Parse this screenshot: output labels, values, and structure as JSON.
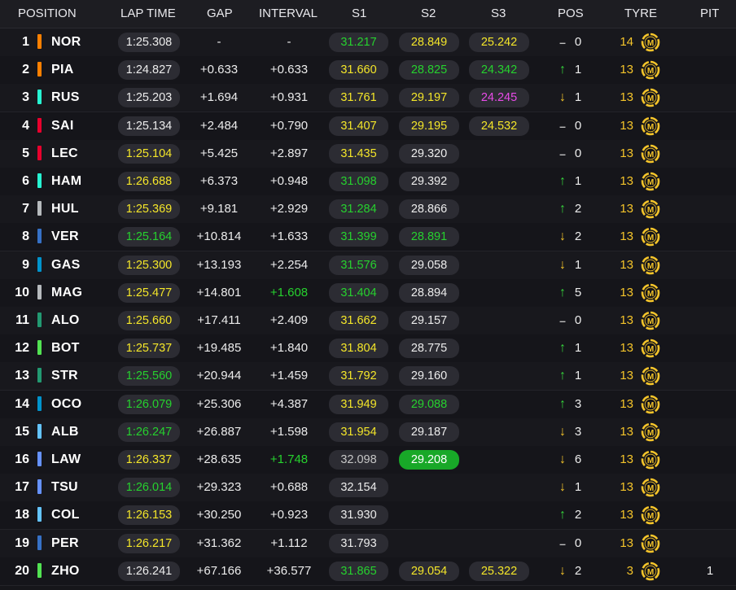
{
  "headers": {
    "position": "POSITION",
    "lap_time": "LAP TIME",
    "gap": "GAP",
    "interval": "INTERVAL",
    "s1": "S1",
    "s2": "S2",
    "s3": "S3",
    "pos": "POS",
    "tyre": "TYRE",
    "pit": "PIT"
  },
  "colors": {
    "green": "#26d12e",
    "yellow": "#f4e629",
    "purple": "#e84be8",
    "tyre_medium": "#f4c42a"
  },
  "rows": [
    {
      "pos": "1",
      "code": "NOR",
      "team_color": "#ff8000",
      "lap": "1:25.308",
      "lap_c": "white",
      "gap": "-",
      "interval": "-",
      "int_c": "white",
      "s1": "31.217",
      "s1_c": "green",
      "s2": "28.849",
      "s2_c": "yellow",
      "s3": "25.242",
      "s3_c": "yellow",
      "arrow": "same",
      "change": "0",
      "laps": "14",
      "tyre": "M",
      "pit": ""
    },
    {
      "pos": "2",
      "code": "PIA",
      "team_color": "#ff8000",
      "lap": "1:24.827",
      "lap_c": "white",
      "gap": "+0.633",
      "interval": "+0.633",
      "int_c": "white",
      "s1": "31.660",
      "s1_c": "yellow",
      "s2": "28.825",
      "s2_c": "green",
      "s3": "24.342",
      "s3_c": "green",
      "arrow": "up",
      "change": "1",
      "laps": "13",
      "tyre": "M",
      "pit": ""
    },
    {
      "pos": "3",
      "code": "RUS",
      "team_color": "#27f4d2",
      "lap": "1:25.203",
      "lap_c": "white",
      "gap": "+1.694",
      "interval": "+0.931",
      "int_c": "white",
      "s1": "31.761",
      "s1_c": "yellow",
      "s2": "29.197",
      "s2_c": "yellow",
      "s3": "24.245",
      "s3_c": "purple",
      "arrow": "down",
      "change": "1",
      "laps": "13",
      "tyre": "M",
      "pit": ""
    },
    {
      "pos": "4",
      "code": "SAI",
      "team_color": "#e8002d",
      "lap": "1:25.134",
      "lap_c": "white",
      "gap": "+2.484",
      "interval": "+0.790",
      "int_c": "white",
      "s1": "31.407",
      "s1_c": "yellow",
      "s2": "29.195",
      "s2_c": "yellow",
      "s3": "24.532",
      "s3_c": "yellow",
      "arrow": "same",
      "change": "0",
      "laps": "13",
      "tyre": "M",
      "pit": ""
    },
    {
      "pos": "5",
      "code": "LEC",
      "team_color": "#e8002d",
      "lap": "1:25.104",
      "lap_c": "yellow",
      "gap": "+5.425",
      "interval": "+2.897",
      "int_c": "white",
      "s1": "31.435",
      "s1_c": "yellow",
      "s2": "29.320",
      "s2_c": "white",
      "s3": "",
      "s3_c": "white",
      "arrow": "same",
      "change": "0",
      "laps": "13",
      "tyre": "M",
      "pit": ""
    },
    {
      "pos": "6",
      "code": "HAM",
      "team_color": "#27f4d2",
      "lap": "1:26.688",
      "lap_c": "yellow",
      "gap": "+6.373",
      "interval": "+0.948",
      "int_c": "white",
      "s1": "31.098",
      "s1_c": "green",
      "s2": "29.392",
      "s2_c": "white",
      "s3": "",
      "s3_c": "white",
      "arrow": "up",
      "change": "1",
      "laps": "13",
      "tyre": "M",
      "pit": ""
    },
    {
      "pos": "7",
      "code": "HUL",
      "team_color": "#b6babd",
      "lap": "1:25.369",
      "lap_c": "yellow",
      "gap": "+9.181",
      "interval": "+2.929",
      "int_c": "white",
      "s1": "31.284",
      "s1_c": "green",
      "s2": "28.866",
      "s2_c": "white",
      "s3": "",
      "s3_c": "white",
      "arrow": "up",
      "change": "2",
      "laps": "13",
      "tyre": "M",
      "pit": ""
    },
    {
      "pos": "8",
      "code": "VER",
      "team_color": "#3671c6",
      "lap": "1:25.164",
      "lap_c": "green",
      "gap": "+10.814",
      "interval": "+1.633",
      "int_c": "white",
      "s1": "31.399",
      "s1_c": "green",
      "s2": "28.891",
      "s2_c": "green",
      "s3": "",
      "s3_c": "white",
      "arrow": "down",
      "change": "2",
      "laps": "13",
      "tyre": "M",
      "pit": ""
    },
    {
      "pos": "9",
      "code": "GAS",
      "team_color": "#0093cc",
      "lap": "1:25.300",
      "lap_c": "yellow",
      "gap": "+13.193",
      "interval": "+2.254",
      "int_c": "white",
      "s1": "31.576",
      "s1_c": "green",
      "s2": "29.058",
      "s2_c": "white",
      "s3": "",
      "s3_c": "white",
      "arrow": "down",
      "change": "1",
      "laps": "13",
      "tyre": "M",
      "pit": ""
    },
    {
      "pos": "10",
      "code": "MAG",
      "team_color": "#b6babd",
      "lap": "1:25.477",
      "lap_c": "yellow",
      "gap": "+14.801",
      "interval": "+1.608",
      "int_c": "green",
      "s1": "31.404",
      "s1_c": "green",
      "s2": "28.894",
      "s2_c": "white",
      "s3": "",
      "s3_c": "white",
      "arrow": "up",
      "change": "5",
      "laps": "13",
      "tyre": "M",
      "pit": ""
    },
    {
      "pos": "11",
      "code": "ALO",
      "team_color": "#229971",
      "lap": "1:25.660",
      "lap_c": "yellow",
      "gap": "+17.411",
      "interval": "+2.409",
      "int_c": "white",
      "s1": "31.662",
      "s1_c": "yellow",
      "s2": "29.157",
      "s2_c": "white",
      "s3": "",
      "s3_c": "white",
      "arrow": "same",
      "change": "0",
      "laps": "13",
      "tyre": "M",
      "pit": ""
    },
    {
      "pos": "12",
      "code": "BOT",
      "team_color": "#52e252",
      "lap": "1:25.737",
      "lap_c": "yellow",
      "gap": "+19.485",
      "interval": "+1.840",
      "int_c": "white",
      "s1": "31.804",
      "s1_c": "yellow",
      "s2": "28.775",
      "s2_c": "white",
      "s3": "",
      "s3_c": "white",
      "arrow": "up",
      "change": "1",
      "laps": "13",
      "tyre": "M",
      "pit": ""
    },
    {
      "pos": "13",
      "code": "STR",
      "team_color": "#229971",
      "lap": "1:25.560",
      "lap_c": "green",
      "gap": "+20.944",
      "interval": "+1.459",
      "int_c": "white",
      "s1": "31.792",
      "s1_c": "yellow",
      "s2": "29.160",
      "s2_c": "white",
      "s3": "",
      "s3_c": "white",
      "arrow": "up",
      "change": "1",
      "laps": "13",
      "tyre": "M",
      "pit": ""
    },
    {
      "pos": "14",
      "code": "OCO",
      "team_color": "#0093cc",
      "lap": "1:26.079",
      "lap_c": "green",
      "gap": "+25.306",
      "interval": "+4.387",
      "int_c": "white",
      "s1": "31.949",
      "s1_c": "yellow",
      "s2": "29.088",
      "s2_c": "green",
      "s3": "",
      "s3_c": "white",
      "arrow": "up",
      "change": "3",
      "laps": "13",
      "tyre": "M",
      "pit": ""
    },
    {
      "pos": "15",
      "code": "ALB",
      "team_color": "#64c4ff",
      "lap": "1:26.247",
      "lap_c": "green",
      "gap": "+26.887",
      "interval": "+1.598",
      "int_c": "white",
      "s1": "31.954",
      "s1_c": "yellow",
      "s2": "29.187",
      "s2_c": "white",
      "s3": "",
      "s3_c": "white",
      "arrow": "down",
      "change": "3",
      "laps": "13",
      "tyre": "M",
      "pit": ""
    },
    {
      "pos": "16",
      "code": "LAW",
      "team_color": "#6692ff",
      "lap": "1:26.337",
      "lap_c": "yellow",
      "gap": "+28.635",
      "interval": "+1.748",
      "int_c": "green",
      "s1": "32.098",
      "s1_c": "gray",
      "s2": "29.208",
      "s2_c": "bg-green",
      "s3": "",
      "s3_c": "white",
      "arrow": "down",
      "change": "6",
      "laps": "13",
      "tyre": "M",
      "pit": ""
    },
    {
      "pos": "17",
      "code": "TSU",
      "team_color": "#6692ff",
      "lap": "1:26.014",
      "lap_c": "green",
      "gap": "+29.323",
      "interval": "+0.688",
      "int_c": "white",
      "s1": "32.154",
      "s1_c": "white",
      "s2": "",
      "s2_c": "white",
      "s3": "",
      "s3_c": "white",
      "arrow": "down",
      "change": "1",
      "laps": "13",
      "tyre": "M",
      "pit": ""
    },
    {
      "pos": "18",
      "code": "COL",
      "team_color": "#64c4ff",
      "lap": "1:26.153",
      "lap_c": "yellow",
      "gap": "+30.250",
      "interval": "+0.923",
      "int_c": "white",
      "s1": "31.930",
      "s1_c": "white",
      "s2": "",
      "s2_c": "white",
      "s3": "",
      "s3_c": "white",
      "arrow": "up",
      "change": "2",
      "laps": "13",
      "tyre": "M",
      "pit": ""
    },
    {
      "pos": "19",
      "code": "PER",
      "team_color": "#3671c6",
      "lap": "1:26.217",
      "lap_c": "yellow",
      "gap": "+31.362",
      "interval": "+1.112",
      "int_c": "white",
      "s1": "31.793",
      "s1_c": "white",
      "s2": "",
      "s2_c": "white",
      "s3": "",
      "s3_c": "white",
      "arrow": "same",
      "change": "0",
      "laps": "13",
      "tyre": "M",
      "pit": ""
    },
    {
      "pos": "20",
      "code": "ZHO",
      "team_color": "#52e252",
      "lap": "1:26.241",
      "lap_c": "white",
      "gap": "+67.166",
      "interval": "+36.577",
      "int_c": "white",
      "s1": "31.865",
      "s1_c": "green",
      "s2": "29.054",
      "s2_c": "yellow",
      "s3": "25.322",
      "s3_c": "yellow",
      "arrow": "down",
      "change": "2",
      "laps": "3",
      "tyre": "M",
      "pit": "1"
    }
  ]
}
